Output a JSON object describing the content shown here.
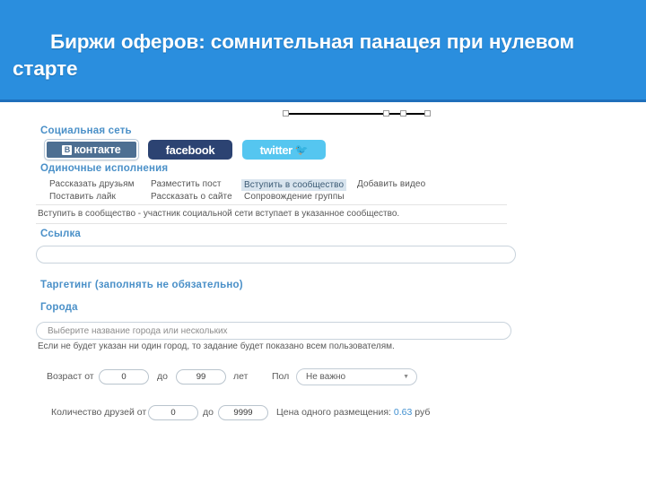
{
  "slide": {
    "title": "Биржи оферов: сомнительная панацея при нулевом старте",
    "header_color": "#2a8ede"
  },
  "form": {
    "social_label": "Социальная сеть",
    "social_buttons": [
      {
        "name": "vk",
        "label": "контакте",
        "badge": "В",
        "color": "#4d6f92"
      },
      {
        "name": "facebook",
        "label": "facebook",
        "color": "#2c4372"
      },
      {
        "name": "twitter",
        "label": "twitter",
        "color": "#55c6f0"
      }
    ],
    "actions_label": "Одиночные исполнения",
    "actions": [
      {
        "label": "Рассказать друзьям",
        "selected": false
      },
      {
        "label": "Разместить пост",
        "selected": false
      },
      {
        "label": "Вступить в сообщество",
        "selected": true
      },
      {
        "label": "Добавить видео",
        "selected": false
      },
      {
        "label": "Поставить лайк",
        "selected": false
      },
      {
        "label": "Рассказать о сайте",
        "selected": false
      },
      {
        "label": "Сопровождение группы",
        "selected": false
      }
    ],
    "action_description": "Вступить в сообщество - участник социальной сети вступает в указанное сообщество.",
    "link_label": "Ссылка",
    "link_value": "",
    "link_placeholder": "",
    "targeting_label": "Таргетинг (заполнять не обязательно)",
    "cities_label": "Города",
    "cities_placeholder": "Выберите название города или нескольких",
    "cities_hint": "Если не будет указан ни один город, то задание будет показано всем пользователям.",
    "age": {
      "label_from": "Возраст от",
      "from": "0",
      "label_to": "до",
      "to": "99",
      "label_unit": "лет"
    },
    "gender": {
      "label": "Пол",
      "value": "Не важно",
      "caret": "chevron-down-icon"
    },
    "friends": {
      "label_from": "Количество друзей от",
      "from": "0",
      "label_to": "до",
      "to": "9999"
    },
    "price": {
      "label": "Цена одного размещения:",
      "value": "0.63",
      "currency": "руб",
      "color": "#3f8fd0"
    }
  }
}
